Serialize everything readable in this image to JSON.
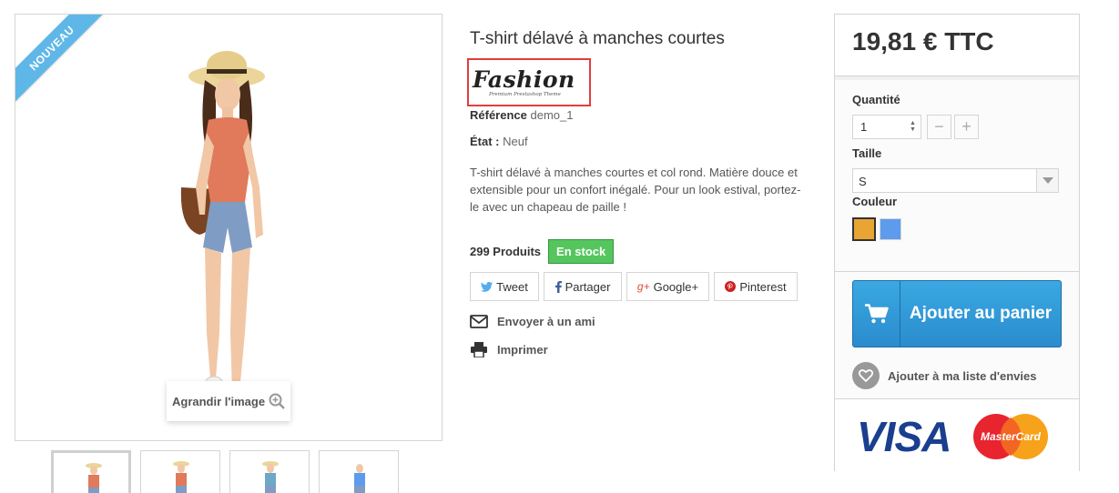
{
  "product": {
    "badge": "NOUVEAU",
    "title": "T-shirt délavé à manches courtes",
    "brand_name": "Fashion",
    "brand_tagline": "Premium Prestashop Theme",
    "reference_label": "Référence",
    "reference_value": "demo_1",
    "state_label": "État :",
    "state_value": "Neuf",
    "description": "T-shirt délavé à manches courtes et col rond. Matière douce et extensible pour un confort inégalé. Pour un look estival, portez-le avec un chapeau de paille !",
    "quantity_text": "299 Produits",
    "stock_status": "En stock",
    "enlarge_label": "Agrandir l'image",
    "thumbnails_count": 4
  },
  "social": {
    "tweet": "Tweet",
    "share": "Partager",
    "google": "Google+",
    "pinterest": "Pinterest"
  },
  "actions": {
    "send_friend": "Envoyer à un ami",
    "print": "Imprimer"
  },
  "buy_box": {
    "price": "19,81 € TTC",
    "quantity_label": "Quantité",
    "quantity_value": "1",
    "size_label": "Taille",
    "size_value": "S",
    "color_label": "Couleur",
    "colors": [
      "#e8a534",
      "#5d9cec"
    ],
    "add_to_cart": "Ajouter au panier",
    "wishlist": "Ajouter à ma liste d'envies",
    "payment_visa": "VISA",
    "payment_mastercard": "MasterCard"
  },
  "colors": {
    "accent_blue": "#2a8ccd",
    "stock_green": "#55c65e",
    "ribbon": "#5fb7e8",
    "brand_highlight": "#e23d3d"
  }
}
